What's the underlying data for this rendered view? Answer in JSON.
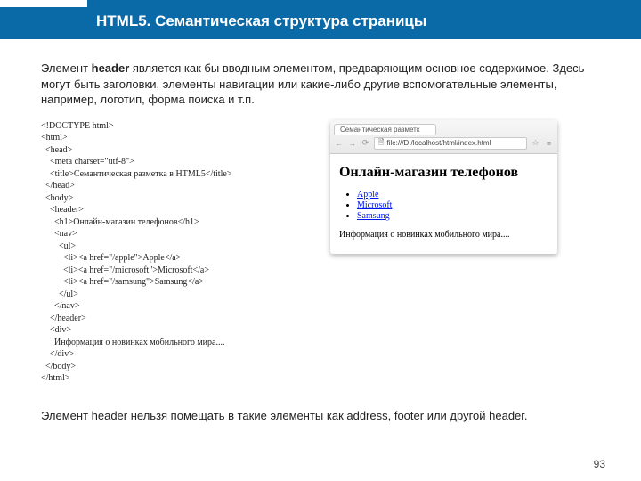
{
  "banner": {
    "title": "HTML5. Семантическая структура страницы"
  },
  "intro": {
    "prefix": "Элемент ",
    "bold": "header",
    "rest": " является как бы вводным элементом, предваряющим основное содержимое. Здесь могут быть заголовки, элементы навигации или какие-либо другие вспомогательные элементы, например, логотип, форма поиска и т.п."
  },
  "code": "<!DOCTYPE html>\n<html>\n  <head>\n    <meta charset=\"utf-8\">\n    <title>Семантическая разметка в HTML5</title>\n  </head>\n  <body>\n    <header>\n      <h1>Онлайн-магазин телефонов</h1>\n      <nav>\n        <ul>\n          <li><a href=\"/apple\">Apple</a>\n          <li><a href=\"/microsoft\">Microsoft</a>\n          <li><a href=\"/samsung\">Samsung</a>\n        </ul>\n      </nav>\n    </header>\n    <div>\n      Информация о новинках мобильного мира....\n    </div>\n  </body>\n</html>",
  "browser": {
    "tab_title": "Семантическая разметк",
    "nav": {
      "back": "←",
      "forward": "→",
      "reload": "⟳"
    },
    "doc_icon": "🗎",
    "url": "file:///D:/localhost/html/index.html",
    "star": "☆",
    "menu": "≡"
  },
  "rendered": {
    "heading": "Онлайн-магазин телефонов",
    "links": [
      "Apple",
      "Microsoft",
      "Samsung"
    ],
    "paragraph": "Информация о новинках мобильного мира...."
  },
  "outro": "Элемент header нельзя помещать в такие элементы как address, footer или другой header.",
  "page_number": "93"
}
